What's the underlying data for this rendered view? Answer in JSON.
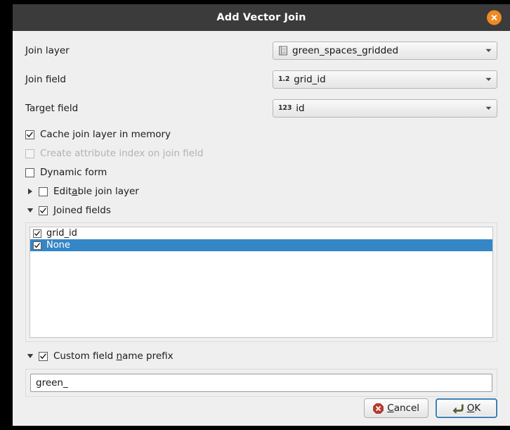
{
  "window": {
    "title": "Add Vector Join",
    "close_icon": "close-icon"
  },
  "form": {
    "rows": [
      {
        "label": "Join layer",
        "value": "green_spaces_gridded",
        "icon": "vector-layer-icon"
      },
      {
        "label": "Join field",
        "value": "grid_id",
        "icon": "field-type-decimal-icon",
        "type_badge": "1.2"
      },
      {
        "label": "Target field",
        "value": "id",
        "icon": "field-type-integer-icon",
        "type_badge": "123"
      }
    ]
  },
  "options": {
    "cache_join_layer": {
      "label": "Cache join layer in memory",
      "checked": true,
      "enabled": true
    },
    "create_attribute_index": {
      "label": "Create attribute index on join field",
      "checked": false,
      "enabled": false
    },
    "dynamic_form": {
      "label": "Dynamic form",
      "checked": false,
      "enabled": true
    },
    "editable_join_layer": {
      "label_pre": "Edit",
      "label_mnemonic": "a",
      "label_post": "ble join layer",
      "checked": false,
      "expanded": false
    },
    "joined_fields": {
      "label_pre": "",
      "label_mnemonic": "J",
      "label_post": "oined fields",
      "checked": true,
      "expanded": true
    },
    "custom_prefix": {
      "label_pre": "Custom field ",
      "label_mnemonic": "n",
      "label_post": "ame prefix",
      "checked": true,
      "expanded": true
    }
  },
  "joined_fields_list": {
    "items": [
      {
        "label": "grid_id",
        "checked": true,
        "selected": false
      },
      {
        "label": "None",
        "checked": true,
        "selected": true
      }
    ]
  },
  "prefix_input": {
    "value": "green_",
    "placeholder": ""
  },
  "buttons": {
    "cancel": {
      "label_pre": "",
      "label_mnemonic": "C",
      "label_post": "ancel",
      "icon": "cancel-icon"
    },
    "ok": {
      "label_pre": "",
      "label_mnemonic": "O",
      "label_post": "K",
      "icon": "ok-arrow-icon",
      "focused": true
    }
  },
  "colors": {
    "titlebar": "#3b3b3b",
    "close_button": "#ef8a23",
    "dialog_background": "#efefef",
    "selection_blue": "#3586c6",
    "focus_blue": "#3f7fb5",
    "cancel_red": "#c0392b",
    "ok_green": "#5d6b34"
  }
}
